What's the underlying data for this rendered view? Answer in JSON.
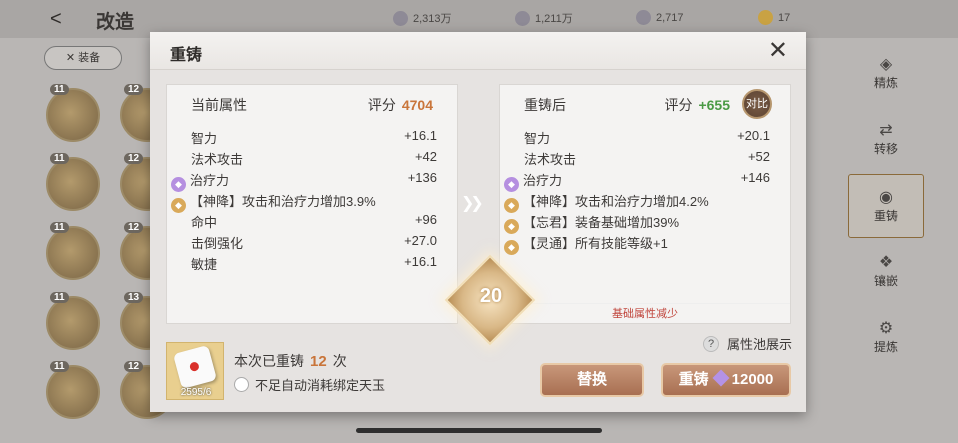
{
  "background": {
    "title": "改造",
    "currencies": [
      {
        "icon": "crystal-icon",
        "value": "2,313万"
      },
      {
        "icon": "gear-coin-icon",
        "value": "1,211万"
      },
      {
        "icon": "gem-icon",
        "value": "2,717"
      },
      {
        "icon": "gold-coin-icon",
        "value": "17"
      }
    ],
    "equip_tab": "✕ 装备",
    "slot_levels": [
      "11",
      "11",
      "11",
      "11",
      "11",
      "12",
      "12",
      "12",
      "13",
      "12"
    ],
    "menu": [
      {
        "label": "精炼",
        "icon": "refine-icon"
      },
      {
        "label": "转移",
        "icon": "transfer-icon"
      },
      {
        "label": "重铸",
        "icon": "reforge-icon"
      },
      {
        "label": "镶嵌",
        "icon": "inlay-icon"
      },
      {
        "label": "提炼",
        "icon": "extract-icon"
      }
    ]
  },
  "dialog": {
    "title": "重铸",
    "current": {
      "title": "当前属性",
      "score_label": "评分",
      "score": "4704",
      "attrs": [
        {
          "name": "智力",
          "value": "+16.1"
        },
        {
          "name": "法术攻击",
          "value": "+42"
        },
        {
          "name": "治疗力",
          "value": "+136",
          "icon": "purple"
        },
        {
          "name": "【神降】攻击和治疗力增加3.9%",
          "value": "",
          "icon": "gold"
        },
        {
          "name": "命中",
          "value": "+96"
        },
        {
          "name": "击倒强化",
          "value": "+27.0"
        },
        {
          "name": "敏捷",
          "value": "+16.1"
        }
      ]
    },
    "after": {
      "title": "重铸后",
      "score_label": "评分",
      "score": "+655",
      "compare_label": "对比",
      "attrs": [
        {
          "name": "智力",
          "value": "+20.1"
        },
        {
          "name": "法术攻击",
          "value": "+52"
        },
        {
          "name": "治疗力",
          "value": "+146",
          "icon": "purple"
        },
        {
          "name": "【神降】攻击和治疗力增加4.2%",
          "value": "",
          "icon": "gold"
        },
        {
          "name": "【忘君】装备基础增加39%",
          "value": "",
          "icon": "gold"
        },
        {
          "name": "【灵通】所有技能等级+1",
          "value": "",
          "icon": "gold"
        }
      ],
      "note": "基础属性减少"
    },
    "reforge_badge": "20",
    "dice_count": "2595/6",
    "reforge_count_prefix": "本次已重铸",
    "reforge_count": "12",
    "reforge_count_suffix": "次",
    "auto_consume_label": "不足自动消耗绑定天玉",
    "pool_label": "属性池展示",
    "replace_button": "替换",
    "reforge_button": "重铸",
    "reforge_cost": "12000"
  }
}
